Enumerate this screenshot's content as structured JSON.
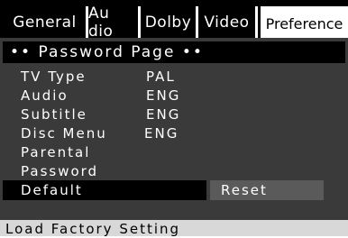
{
  "tabs": [
    {
      "label": "General",
      "active": false
    },
    {
      "label": "Au dio",
      "active": false
    },
    {
      "label": "Dolby",
      "active": false
    },
    {
      "label": "Video",
      "active": false
    },
    {
      "label": "Preference",
      "active": true
    }
  ],
  "page_title": "•• Password Page ••",
  "rows": [
    {
      "label": "TV Type",
      "value": "PAL"
    },
    {
      "label": "Audio",
      "value": "ENG"
    },
    {
      "label": "Subtitle",
      "value": "ENG"
    },
    {
      "label": "Disc Menu",
      "value": "ENG"
    },
    {
      "label": "Parental",
      "value": ""
    },
    {
      "label": "Password",
      "value": ""
    },
    {
      "label": "Default",
      "value": ""
    }
  ],
  "reset_label": "Reset",
  "status": "Load Factory Setting",
  "colors": {
    "background": "#000000",
    "panel": "#3a3a3a",
    "selected_bar": "#000000",
    "button": "#5a5a5a",
    "status_bar": "#d8d8d8"
  }
}
